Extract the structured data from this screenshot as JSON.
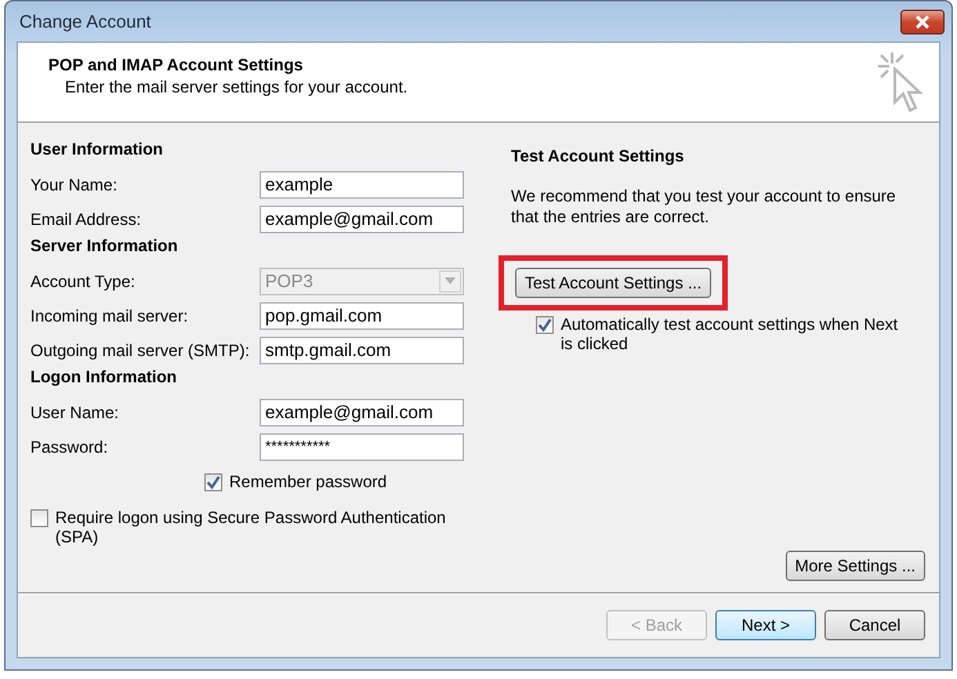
{
  "window": {
    "title": "Change Account"
  },
  "header": {
    "title": "POP and IMAP Account Settings",
    "subtitle": "Enter the mail server settings for your account."
  },
  "sections": [
    {
      "title": "User Information",
      "fields": [
        {
          "label": "Your Name:",
          "kind": "text",
          "value": "example",
          "disabled": false
        },
        {
          "label": "Email Address:",
          "kind": "text",
          "value": "example@gmail.com",
          "disabled": false
        }
      ]
    },
    {
      "title": "Server Information",
      "fields": [
        {
          "label": "Account Type:",
          "kind": "dropdown",
          "value": "POP3",
          "disabled": true
        },
        {
          "label": "Incoming mail server:",
          "kind": "text",
          "value": "pop.gmail.com",
          "disabled": false
        },
        {
          "label": "Outgoing mail server (SMTP):",
          "kind": "text",
          "value": "smtp.gmail.com",
          "disabled": false
        }
      ]
    },
    {
      "title": "Logon Information",
      "fields": [
        {
          "label": "User Name:",
          "kind": "text",
          "value": "example@gmail.com",
          "disabled": false
        },
        {
          "label": "Password:",
          "kind": "password",
          "value": "***********",
          "disabled": false
        }
      ]
    }
  ],
  "remember_password": {
    "label": "Remember password",
    "checked": true
  },
  "require_spa": {
    "label": "Require logon using Secure Password Authentication (SPA)",
    "checked": false
  },
  "test_settings": {
    "title": "Test Account Settings",
    "description": "We recommend that you test your account to ensure that the entries are correct.",
    "button": {
      "label": "Test Account Settings ...",
      "highlighted": true
    },
    "auto_test": {
      "label": "Automatically test account settings when Next is clicked",
      "checked": true
    }
  },
  "more_settings_button": "More Settings ...",
  "buttons": [
    {
      "label": "< Back",
      "disabled": true,
      "default": false
    },
    {
      "label": "Next >",
      "disabled": false,
      "default": true
    },
    {
      "label": "Cancel",
      "disabled": false,
      "default": false
    }
  ]
}
